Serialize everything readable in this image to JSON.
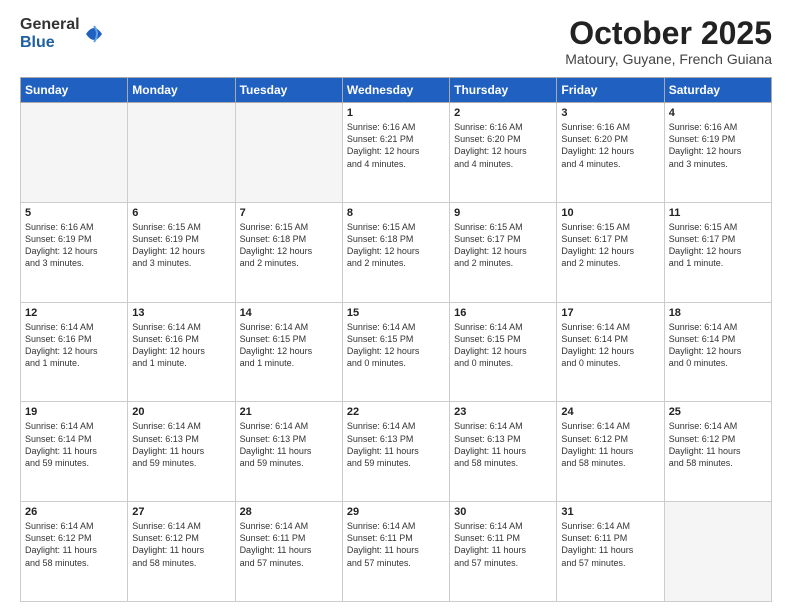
{
  "logo": {
    "general": "General",
    "blue": "Blue"
  },
  "header": {
    "month": "October 2025",
    "location": "Matoury, Guyane, French Guiana"
  },
  "weekdays": [
    "Sunday",
    "Monday",
    "Tuesday",
    "Wednesday",
    "Thursday",
    "Friday",
    "Saturday"
  ],
  "weeks": [
    [
      {
        "day": "",
        "info": ""
      },
      {
        "day": "",
        "info": ""
      },
      {
        "day": "",
        "info": ""
      },
      {
        "day": "1",
        "info": "Sunrise: 6:16 AM\nSunset: 6:21 PM\nDaylight: 12 hours\nand 4 minutes."
      },
      {
        "day": "2",
        "info": "Sunrise: 6:16 AM\nSunset: 6:20 PM\nDaylight: 12 hours\nand 4 minutes."
      },
      {
        "day": "3",
        "info": "Sunrise: 6:16 AM\nSunset: 6:20 PM\nDaylight: 12 hours\nand 4 minutes."
      },
      {
        "day": "4",
        "info": "Sunrise: 6:16 AM\nSunset: 6:19 PM\nDaylight: 12 hours\nand 3 minutes."
      }
    ],
    [
      {
        "day": "5",
        "info": "Sunrise: 6:16 AM\nSunset: 6:19 PM\nDaylight: 12 hours\nand 3 minutes."
      },
      {
        "day": "6",
        "info": "Sunrise: 6:15 AM\nSunset: 6:19 PM\nDaylight: 12 hours\nand 3 minutes."
      },
      {
        "day": "7",
        "info": "Sunrise: 6:15 AM\nSunset: 6:18 PM\nDaylight: 12 hours\nand 2 minutes."
      },
      {
        "day": "8",
        "info": "Sunrise: 6:15 AM\nSunset: 6:18 PM\nDaylight: 12 hours\nand 2 minutes."
      },
      {
        "day": "9",
        "info": "Sunrise: 6:15 AM\nSunset: 6:17 PM\nDaylight: 12 hours\nand 2 minutes."
      },
      {
        "day": "10",
        "info": "Sunrise: 6:15 AM\nSunset: 6:17 PM\nDaylight: 12 hours\nand 2 minutes."
      },
      {
        "day": "11",
        "info": "Sunrise: 6:15 AM\nSunset: 6:17 PM\nDaylight: 12 hours\nand 1 minute."
      }
    ],
    [
      {
        "day": "12",
        "info": "Sunrise: 6:14 AM\nSunset: 6:16 PM\nDaylight: 12 hours\nand 1 minute."
      },
      {
        "day": "13",
        "info": "Sunrise: 6:14 AM\nSunset: 6:16 PM\nDaylight: 12 hours\nand 1 minute."
      },
      {
        "day": "14",
        "info": "Sunrise: 6:14 AM\nSunset: 6:15 PM\nDaylight: 12 hours\nand 1 minute."
      },
      {
        "day": "15",
        "info": "Sunrise: 6:14 AM\nSunset: 6:15 PM\nDaylight: 12 hours\nand 0 minutes."
      },
      {
        "day": "16",
        "info": "Sunrise: 6:14 AM\nSunset: 6:15 PM\nDaylight: 12 hours\nand 0 minutes."
      },
      {
        "day": "17",
        "info": "Sunrise: 6:14 AM\nSunset: 6:14 PM\nDaylight: 12 hours\nand 0 minutes."
      },
      {
        "day": "18",
        "info": "Sunrise: 6:14 AM\nSunset: 6:14 PM\nDaylight: 12 hours\nand 0 minutes."
      }
    ],
    [
      {
        "day": "19",
        "info": "Sunrise: 6:14 AM\nSunset: 6:14 PM\nDaylight: 11 hours\nand 59 minutes."
      },
      {
        "day": "20",
        "info": "Sunrise: 6:14 AM\nSunset: 6:13 PM\nDaylight: 11 hours\nand 59 minutes."
      },
      {
        "day": "21",
        "info": "Sunrise: 6:14 AM\nSunset: 6:13 PM\nDaylight: 11 hours\nand 59 minutes."
      },
      {
        "day": "22",
        "info": "Sunrise: 6:14 AM\nSunset: 6:13 PM\nDaylight: 11 hours\nand 59 minutes."
      },
      {
        "day": "23",
        "info": "Sunrise: 6:14 AM\nSunset: 6:13 PM\nDaylight: 11 hours\nand 58 minutes."
      },
      {
        "day": "24",
        "info": "Sunrise: 6:14 AM\nSunset: 6:12 PM\nDaylight: 11 hours\nand 58 minutes."
      },
      {
        "day": "25",
        "info": "Sunrise: 6:14 AM\nSunset: 6:12 PM\nDaylight: 11 hours\nand 58 minutes."
      }
    ],
    [
      {
        "day": "26",
        "info": "Sunrise: 6:14 AM\nSunset: 6:12 PM\nDaylight: 11 hours\nand 58 minutes."
      },
      {
        "day": "27",
        "info": "Sunrise: 6:14 AM\nSunset: 6:12 PM\nDaylight: 11 hours\nand 58 minutes."
      },
      {
        "day": "28",
        "info": "Sunrise: 6:14 AM\nSunset: 6:11 PM\nDaylight: 11 hours\nand 57 minutes."
      },
      {
        "day": "29",
        "info": "Sunrise: 6:14 AM\nSunset: 6:11 PM\nDaylight: 11 hours\nand 57 minutes."
      },
      {
        "day": "30",
        "info": "Sunrise: 6:14 AM\nSunset: 6:11 PM\nDaylight: 11 hours\nand 57 minutes."
      },
      {
        "day": "31",
        "info": "Sunrise: 6:14 AM\nSunset: 6:11 PM\nDaylight: 11 hours\nand 57 minutes."
      },
      {
        "day": "",
        "info": ""
      }
    ]
  ]
}
